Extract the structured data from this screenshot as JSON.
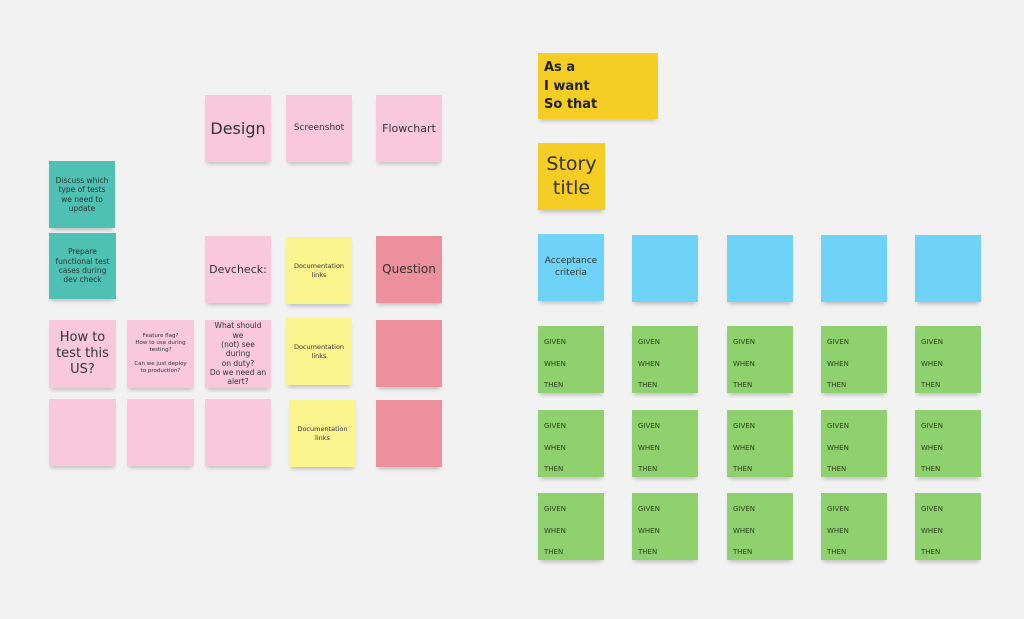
{
  "colors": {
    "background": "#f2f2f2",
    "pink": "#f9c8da",
    "teal": "#4fc0b4",
    "light_yellow": "#fbf590",
    "red": "#ec909d",
    "gold": "#f5cd25",
    "blue": "#6fd2f7",
    "green": "#8fd16f"
  },
  "left_board": {
    "design": "Design",
    "screenshot": "Screenshot",
    "flowchart": "Flowchart",
    "discuss_tests": "Discuss which\ntype  of tests\nwe need to\nupdate",
    "prepare_tests": "Prepare\nfunctional test\ncases during\ndev check",
    "devcheck": "Devcheck:",
    "documentation_links_1": "Documentation\nlinks",
    "question": "Question",
    "how_to_test": "How to\ntest this\nUS?",
    "feature_flag": "Feature flag?\nHow to use during\ntesting?\n\nCan we just deploy\nto production?",
    "on_duty": "What should we\n(not) see during\non duty?\nDo we need an\nalert?",
    "documentation_links_2": "Documentation\nlinks",
    "documentation_links_3": "Documentation\nlinks"
  },
  "right_board": {
    "user_story": "As a\nI want\nSo that",
    "story_title": "Story\ntitle",
    "acceptance_criteria": "Acceptance\ncriteria",
    "gwt_text": "GIVEN\nWHEN\nTHEN"
  }
}
